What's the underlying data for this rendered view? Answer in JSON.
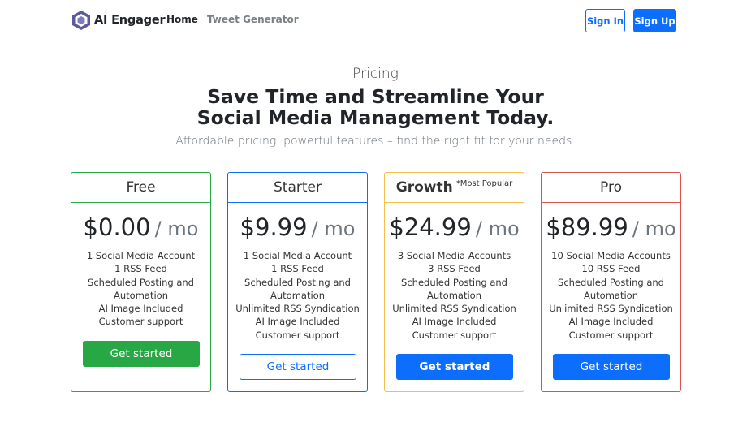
{
  "brand": {
    "name": "AI Engager",
    "logo_icon": "hexagon-logo-icon",
    "logo_color": "#5b5b9c"
  },
  "nav": {
    "home": "Home",
    "tweet_generator": "Tweet Generator"
  },
  "auth": {
    "sign_in": "Sign In",
    "sign_up": "Sign Up"
  },
  "hero": {
    "eyebrow": "Pricing",
    "headline_line1": "Save Time and Streamline Your",
    "headline_line2": "Social Media Management Today.",
    "lead": "Affordable pricing, powerful features – find the right fit for your needs."
  },
  "colors": {
    "primary": "#0d6efd",
    "success": "#28a745",
    "warning": "#f5c04a",
    "danger": "#d9534f"
  },
  "plans": [
    {
      "name": "Free",
      "tag": "",
      "price": "$0.00",
      "period": "/ mo",
      "features": [
        "1 Social Media Account",
        "1 RSS Feed",
        "Scheduled Posting and",
        "Automation",
        "AI Image Included",
        "Customer support"
      ],
      "cta": "Get started"
    },
    {
      "name": "Starter",
      "tag": "",
      "price": "$9.99",
      "period": "/ mo",
      "features": [
        "1 Social Media Account",
        "1 RSS Feed",
        "Scheduled Posting and",
        "Automation",
        "Unlimited RSS Syndication",
        "AI Image Included",
        "Customer support"
      ],
      "cta": "Get started"
    },
    {
      "name": "Growth",
      "tag": "*Most Popular",
      "price": "$24.99",
      "period": "/ mo",
      "features": [
        "3 Social Media Accounts",
        "3 RSS Feed",
        "Scheduled Posting and",
        "Automation",
        "Unlimited RSS Syndication",
        "AI Image Included",
        "Customer support"
      ],
      "cta": "Get started"
    },
    {
      "name": "Pro",
      "tag": "",
      "price": "$89.99",
      "period": "/ mo",
      "features": [
        "10 Social Media Accounts",
        "10 RSS Feed",
        "Scheduled Posting and",
        "Automation",
        "Unlimited RSS Syndication",
        "AI Image Included",
        "Customer support"
      ],
      "cta": "Get started"
    }
  ]
}
